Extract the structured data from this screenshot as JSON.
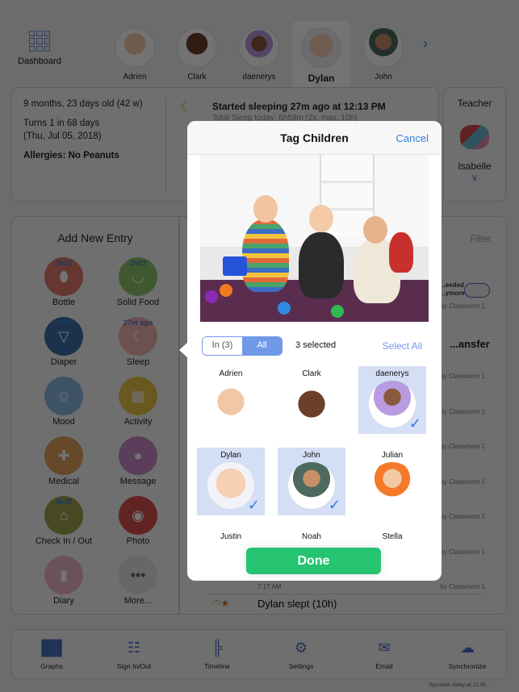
{
  "topbar": {
    "dashboard_label": "Dashboard",
    "dashboard_icon": "grid-icon",
    "children": [
      {
        "name": "Adrien",
        "active": false
      },
      {
        "name": "Clark",
        "active": false
      },
      {
        "name": "daenerys",
        "active": false
      },
      {
        "name": "Dylan",
        "active": true
      },
      {
        "name": "John",
        "active": false
      }
    ],
    "next_icon": "chevron-right-icon"
  },
  "info": {
    "age": "9 months, 23 days old (42 w)",
    "birthday_line1": "Turns 1 in 68 days",
    "birthday_line2": "(Thu, Jul 05, 2018)",
    "allergies": "Allergies: No Peanuts",
    "sleep_status": "Started sleeping 27m ago at 12:13 PM",
    "sleep_total": "Total Sleep today: 6h59m (2x, max: 10h)"
  },
  "teacher": {
    "title": "Teacher",
    "name": "Isabelle"
  },
  "add_entry": {
    "title": "Add New Entry",
    "items": [
      {
        "label": "Bottle",
        "badge": "3h23",
        "color": "#e07a6a",
        "icon": "bottle-icon"
      },
      {
        "label": "Solid Food",
        "badge": "2h23",
        "color": "#8fc46a",
        "icon": "bowl-icon"
      },
      {
        "label": "Diaper",
        "badge": "5h23",
        "color": "#3f6ea8",
        "icon": "diaper-icon"
      },
      {
        "label": "Sleep",
        "badge": "27m ago",
        "color": "#f1b3b3",
        "icon": "moon-icon"
      },
      {
        "label": "Mood",
        "badge": "",
        "color": "#8ab6e6",
        "icon": "baby-face-icon"
      },
      {
        "label": "Activity",
        "badge": "",
        "color": "#e9c64a",
        "icon": "blocks-icon"
      },
      {
        "label": "Medical",
        "badge": "",
        "color": "#e2a35a",
        "icon": "doctor-icon"
      },
      {
        "label": "Message",
        "badge": "",
        "color": "#c98ac9",
        "icon": "speech-bubble-icon"
      },
      {
        "label": "Check In / Out",
        "badge": "4h38",
        "color": "#9ea24e",
        "icon": "house-icon"
      },
      {
        "label": "Photo",
        "badge": "",
        "color": "#d8514f",
        "icon": "camera-icon"
      },
      {
        "label": "Diary",
        "badge": "",
        "color": "#eeb6c4",
        "icon": "diary-icon"
      },
      {
        "label": "More...",
        "badge": "",
        "color": "#e4e4e4",
        "icon": "more-dots-icon"
      }
    ]
  },
  "timeline": {
    "filter_label": "Filter",
    "note_line1": "...eeded",
    "note_line2": "...ymore",
    "transfer_label": "...ansfer",
    "by_label": "by Classroom 1",
    "last_time": "7:17 AM",
    "last_entry": "Dylan slept (10h)"
  },
  "bottom_bar": {
    "items": [
      {
        "label": "Graphs",
        "icon": "bar-chart-icon"
      },
      {
        "label": "Sign In/Out",
        "icon": "keypad-icon"
      },
      {
        "label": "Timeline",
        "icon": "timeline-icon"
      },
      {
        "label": "Settings",
        "icon": "gear-icon"
      },
      {
        "label": "Email",
        "icon": "envelope-icon"
      },
      {
        "label": "Synchronize",
        "icon": "cloud-sync-icon"
      }
    ],
    "synched": "Synched: today at 12:39..."
  },
  "modal": {
    "title": "Tag Children",
    "cancel_label": "Cancel",
    "filter_in": "In (3)",
    "filter_all": "All",
    "filter_selected": "All",
    "selected_count": "3 selected",
    "select_all_label": "Select All",
    "done_label": "Done",
    "children": [
      {
        "name": "Adrien",
        "selected": false
      },
      {
        "name": "Clark",
        "selected": false
      },
      {
        "name": "daenerys",
        "selected": true
      },
      {
        "name": "Dylan",
        "selected": true
      },
      {
        "name": "John",
        "selected": true
      },
      {
        "name": "Julian",
        "selected": false
      },
      {
        "name": "Justin",
        "selected": false
      },
      {
        "name": "Noah",
        "selected": false
      },
      {
        "name": "Stella",
        "selected": false
      }
    ]
  },
  "colors": {
    "accent": "#2f7fe0",
    "done_green": "#26c470",
    "segment_blue": "#7099e8",
    "selected_cell": "#d4def4"
  }
}
